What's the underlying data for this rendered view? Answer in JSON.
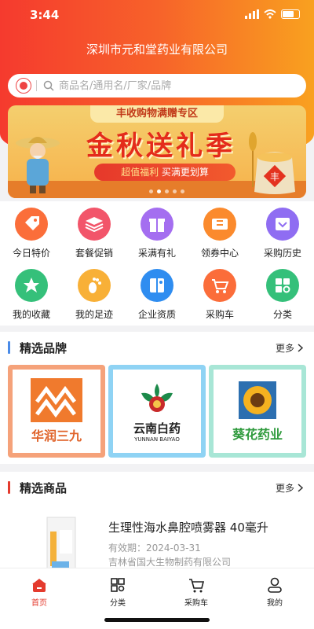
{
  "status_bar": {
    "time": "3:44"
  },
  "header": {
    "title": "深圳市元和堂药业有限公司"
  },
  "search": {
    "placeholder": "商品名/通用名/厂家/品牌"
  },
  "banner": {
    "top_text": "丰收购物满赠专区",
    "main_text": "金秋送礼季",
    "sub_text_a": "超值福利",
    "sub_text_b": "买满更划算",
    "seal_text": "丰",
    "slide_count": 5,
    "active_slide": 1
  },
  "menu": {
    "items": [
      {
        "label": "今日特价",
        "icon": "price-tag-icon",
        "color": "#fb6e3a"
      },
      {
        "label": "套餐促销",
        "icon": "stack-icon",
        "color": "#f2556a"
      },
      {
        "label": "采满有礼",
        "icon": "gift-icon",
        "color": "#a46ef0"
      },
      {
        "label": "领券中心",
        "icon": "coupon-icon",
        "color": "#fb8a2d"
      },
      {
        "label": "采购历史",
        "icon": "history-cart-icon",
        "color": "#8f6df2"
      },
      {
        "label": "我的收藏",
        "icon": "star-icon",
        "color": "#35c07a"
      },
      {
        "label": "我的足迹",
        "icon": "footprint-icon",
        "color": "#f8b037"
      },
      {
        "label": "企业资质",
        "icon": "book-icon",
        "color": "#2f8df0"
      },
      {
        "label": "采购车",
        "icon": "cart-icon",
        "color": "#fb6d3a"
      },
      {
        "label": "分类",
        "icon": "grid-icon",
        "color": "#35c07a"
      }
    ]
  },
  "brands": {
    "title": "精选品牌",
    "more": "更多",
    "items": [
      {
        "name": "华润三九",
        "color": "#f5a27a"
      },
      {
        "name": "云南白药",
        "sub": "YUNNAN BAIYAO",
        "color": "#8fd3f4"
      },
      {
        "name": "葵花药业",
        "color": "#a8e6d6"
      }
    ]
  },
  "products": {
    "title": "精选商品",
    "more": "更多",
    "items": [
      {
        "name": "生理性海水鼻腔喷雾器 40毫升",
        "expiry_label": "有效期：",
        "expiry": "2024-03-31",
        "maker": "吉林省国大生物制药有限公司"
      }
    ]
  },
  "tabbar": {
    "items": [
      {
        "label": "首页",
        "icon": "home-icon",
        "active": true
      },
      {
        "label": "分类",
        "icon": "category-icon",
        "active": false
      },
      {
        "label": "采购车",
        "icon": "cart-icon",
        "active": false
      },
      {
        "label": "我的",
        "icon": "profile-icon",
        "active": false
      }
    ]
  },
  "colors": {
    "accent": "#e43b2e",
    "header_start": "#f53a2e",
    "header_end": "#f9a11f",
    "brand_bar": "#4a8be8",
    "product_bar": "#e43b2e"
  }
}
